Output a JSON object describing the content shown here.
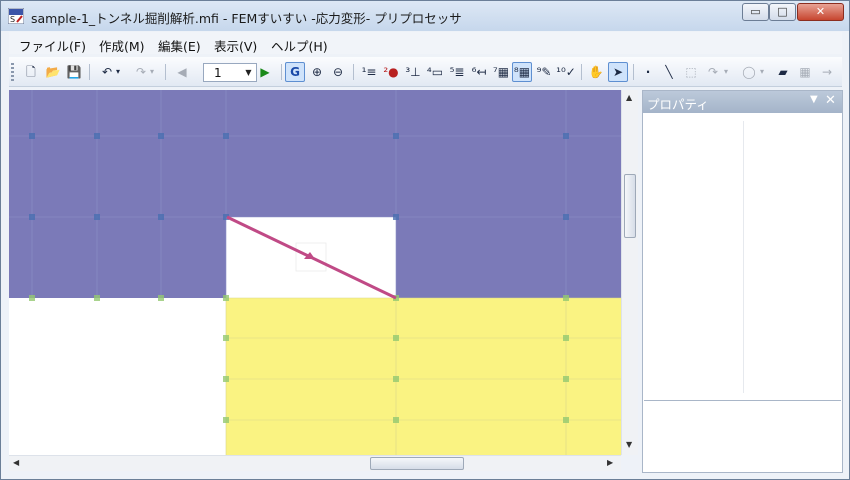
{
  "window": {
    "title": "sample-1_トンネル掘削解析.mfi - FEMすいすい -応力変形- プリプロセッサ",
    "min_label": "▭",
    "max_label": "□",
    "close_label": "✕"
  },
  "menu": [
    {
      "label": "ファイル(F)"
    },
    {
      "label": "作成(M)"
    },
    {
      "label": "編集(E)"
    },
    {
      "label": "表示(V)"
    },
    {
      "label": "ヘルプ(H)"
    }
  ],
  "toolbar": {
    "page_value": "1",
    "icons": [
      {
        "name": "new-file-icon",
        "glyph": "🗋"
      },
      {
        "name": "open-folder-icon",
        "glyph": "📂"
      },
      {
        "name": "save-icon",
        "glyph": "💾"
      },
      {
        "name": "undo-icon",
        "glyph": "↶"
      },
      {
        "name": "redo-icon",
        "glyph": "↷"
      },
      {
        "name": "prev-page-icon",
        "glyph": "◀"
      },
      {
        "name": "next-page-icon",
        "glyph": "▶"
      },
      {
        "name": "grid-toggle-icon",
        "glyph": "G"
      },
      {
        "name": "zoom-in-icon",
        "glyph": "⊕"
      },
      {
        "name": "zoom-out-icon",
        "glyph": "⊖"
      },
      {
        "name": "step-1-icon",
        "glyph": "¹≡"
      },
      {
        "name": "step-2-icon",
        "glyph": "²●"
      },
      {
        "name": "step-3-icon",
        "glyph": "³⊥"
      },
      {
        "name": "step-4-icon",
        "glyph": "⁴▭"
      },
      {
        "name": "step-5-icon",
        "glyph": "⁵≣"
      },
      {
        "name": "step-6-icon",
        "glyph": "⁶↤"
      },
      {
        "name": "step-7-icon",
        "glyph": "⁷▦"
      },
      {
        "name": "step-8-icon",
        "glyph": "⁸▦"
      },
      {
        "name": "step-9-icon",
        "glyph": "⁹✎"
      },
      {
        "name": "step-10-icon",
        "glyph": "¹⁰✓"
      },
      {
        "name": "pan-hand-icon",
        "glyph": "✋"
      },
      {
        "name": "select-pointer-icon",
        "glyph": "➤"
      },
      {
        "name": "point-tool-icon",
        "glyph": "·"
      },
      {
        "name": "line-tool-icon",
        "glyph": "╲"
      },
      {
        "name": "rectangle-tool-icon",
        "glyph": "⬚"
      },
      {
        "name": "arc-tool-icon",
        "glyph": "↷"
      },
      {
        "name": "polygon-tool-icon",
        "glyph": "◯"
      },
      {
        "name": "paint-tool-icon",
        "glyph": "▰"
      },
      {
        "name": "mesh-tool-icon",
        "glyph": "▦"
      },
      {
        "name": "go-icon",
        "glyph": "→"
      }
    ]
  },
  "properties_panel": {
    "title": "プロパティ",
    "pin_label": "▼",
    "close_label": "✕"
  },
  "colors": {
    "upper_layer": "#7b7ab8",
    "lower_layer": "#faf382",
    "excavation_line": "#c04a86",
    "node_marker": "#4a6fb0",
    "node_marker_lower": "#94c870"
  }
}
